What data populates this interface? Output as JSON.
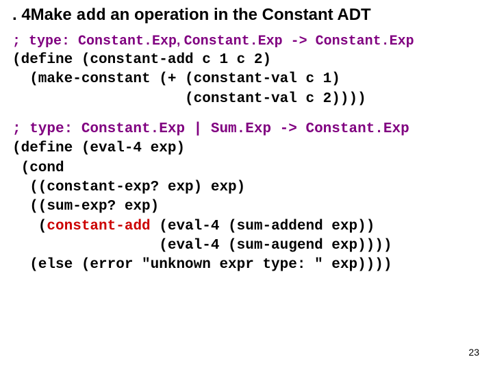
{
  "title_prefix": ". 4Make ",
  "title_add": "add",
  "title_suffix": " an operation in the Constant ADT",
  "c1_type_a": "; type: Constant.Exp",
  "c1_type_comma": ", ",
  "c1_type_b": "Constant.Exp -> Constant.Exp",
  "c1_l1": "(define (constant-add c 1 c 2)",
  "c1_l2": "  (make-constant (+ (constant-val c 1)",
  "c1_l3": "                    (constant-val c 2))))",
  "c2_type": "; type: Constant.Exp | Sum.Exp -> Constant.Exp",
  "c2_l1": "(define (eval-4 exp)",
  "c2_l2": " (cond ",
  "c2_l3": "  ((constant-exp? exp) exp)",
  "c2_l4": "  ((sum-exp? exp)",
  "c2_l5a": "   (",
  "c2_l5b": "constant-add",
  "c2_l5c": " (eval-4 (sum-addend exp))",
  "c2_l6": "                 (eval-4 (sum-augend exp))))",
  "c2_l7": "  (else (error \"unknown expr type: \" exp))))",
  "pagenum": "23",
  "chart_data": {
    "type": "table",
    "title": "4. Make add an operation in the Constant ADT",
    "blocks": [
      {
        "signature": "type: Constant.Exp, Constant.Exp -> Constant.Exp",
        "code": "(define (constant-add c1 c2)\n  (make-constant (+ (constant-val c1)\n                    (constant-val c2))))"
      },
      {
        "signature": "type: Constant.Exp | Sum.Exp -> Constant.Exp",
        "code": "(define (eval-4 exp)\n (cond\n  ((constant-exp? exp) exp)\n  ((sum-exp? exp)\n   (constant-add (eval-4 (sum-addend exp))\n                 (eval-4 (sum-augend exp))))\n  (else (error \"unknown expr type: \" exp))))"
      }
    ]
  }
}
